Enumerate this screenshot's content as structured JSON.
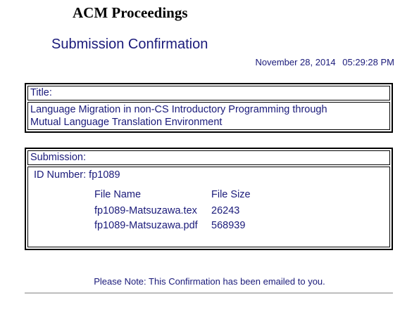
{
  "header": {
    "brand": "ACM Proceedings",
    "title": "Submission Confirmation",
    "date": "November 28, 2014",
    "time": "05:29:28 PM"
  },
  "title_box": {
    "label": "Title:",
    "value_line1": "Language Migration in non-CS Introductory Programming through",
    "value_line2": "Mutual Language Translation Environment"
  },
  "submission_box": {
    "label": "Submission:",
    "id_label": "ID Number:",
    "id_value": "fp1089",
    "col_file_name": "File Name",
    "col_file_size": "File Size",
    "files": [
      {
        "name": "fp1089-Matsuzawa.tex",
        "size": "26243"
      },
      {
        "name": "fp1089-Matsuzawa.pdf",
        "size": "568939"
      }
    ]
  },
  "footer": {
    "note": "Please Note: This Confirmation has been emailed to you."
  }
}
